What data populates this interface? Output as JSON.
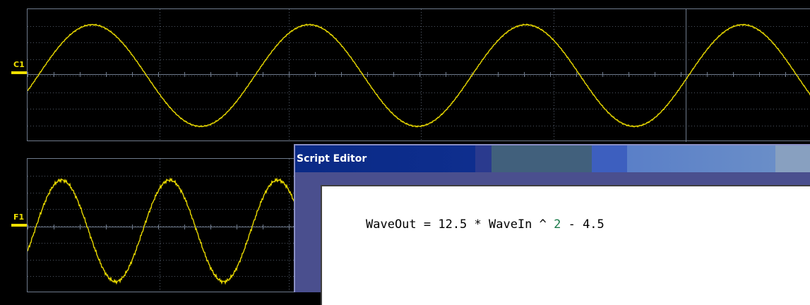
{
  "channels": [
    {
      "id": "c1",
      "label": "C1"
    },
    {
      "id": "f1",
      "label": "F1"
    }
  ],
  "script_editor": {
    "title": "Script Editor",
    "code": {
      "before": "WaveOut = 12.5 * WaveIn ^ ",
      "number": "2",
      "after": " - 4.5"
    }
  },
  "colors": {
    "trace": "#e8d800",
    "grid": "#6e7a8c",
    "background": "#000000",
    "number_token": "#1a7a4a"
  }
}
